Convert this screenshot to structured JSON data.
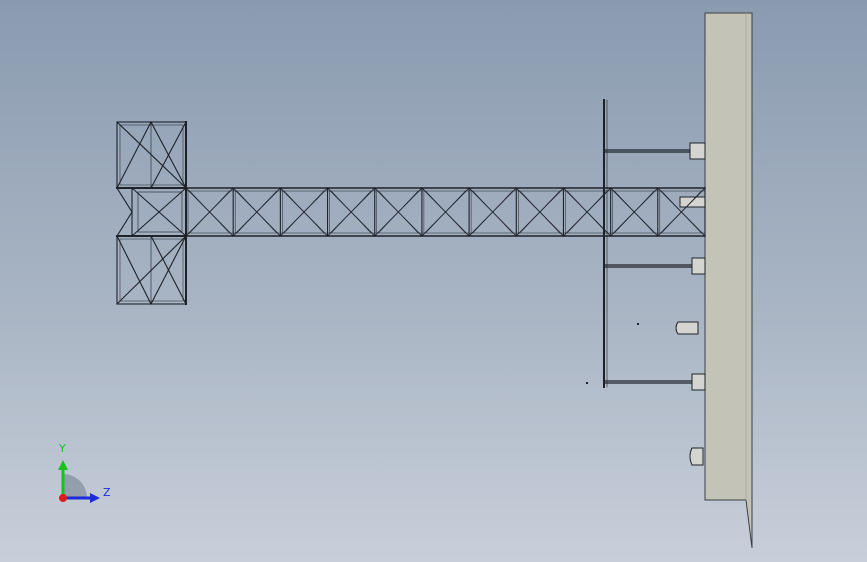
{
  "triad": {
    "y_label": "Y",
    "z_label": "Z",
    "colors": {
      "y": "#16c21d",
      "z": "#1d2bd8",
      "x": "#e01b1b",
      "sector": "#8c97a6"
    }
  },
  "model": {
    "truss_panels": 11,
    "colors": {
      "steel": "#1e2228",
      "wall": "#c3c3b8",
      "wall_edge": "#3b3f45",
      "fitting": "#d4d5d0"
    }
  }
}
